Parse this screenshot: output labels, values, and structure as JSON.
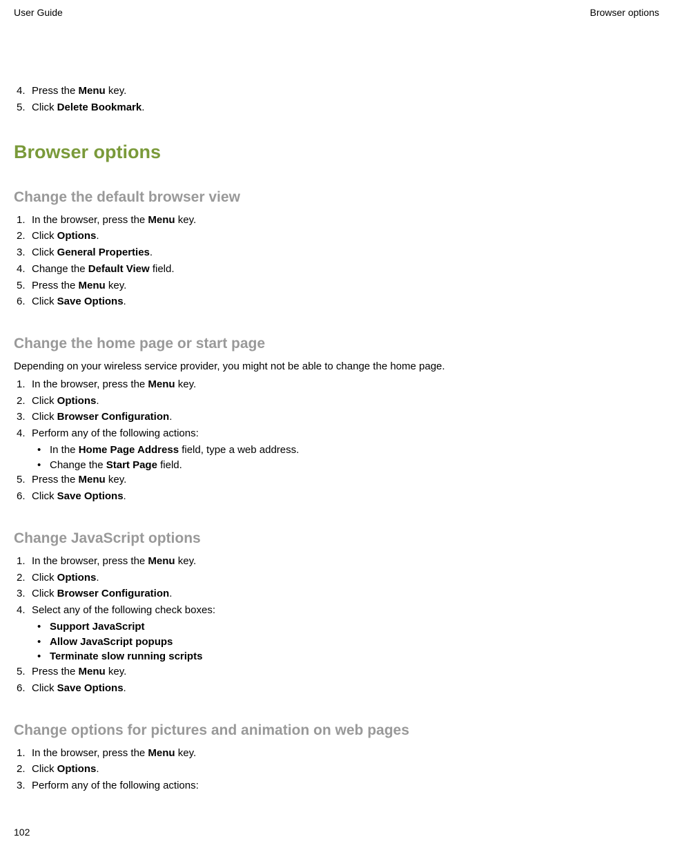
{
  "header": {
    "left": "User Guide",
    "right": "Browser options"
  },
  "intro_steps": [
    {
      "num": "4.",
      "parts": [
        "Press the ",
        "Menu",
        " key."
      ]
    },
    {
      "num": "5.",
      "parts": [
        "Click ",
        "Delete Bookmark",
        "."
      ]
    }
  ],
  "h1": "Browser options",
  "sections": [
    {
      "title": "Change the default browser view",
      "intro": null,
      "items": [
        {
          "type": "step",
          "num": "1.",
          "parts": [
            "In the browser, press the ",
            "Menu",
            " key."
          ]
        },
        {
          "type": "step",
          "num": "2.",
          "parts": [
            "Click ",
            "Options",
            "."
          ]
        },
        {
          "type": "step",
          "num": "3.",
          "parts": [
            "Click ",
            "General Properties",
            "."
          ]
        },
        {
          "type": "step",
          "num": "4.",
          "parts": [
            "Change the ",
            "Default View",
            " field."
          ]
        },
        {
          "type": "step",
          "num": "5.",
          "parts": [
            "Press the ",
            "Menu",
            " key."
          ]
        },
        {
          "type": "step",
          "num": "6.",
          "parts": [
            "Click ",
            "Save Options",
            "."
          ]
        }
      ]
    },
    {
      "title": "Change the home page or start page",
      "intro": "Depending on your wireless service provider, you might not be able to change the home page.",
      "items": [
        {
          "type": "step",
          "num": "1.",
          "parts": [
            "In the browser, press the ",
            "Menu",
            " key."
          ]
        },
        {
          "type": "step",
          "num": "2.",
          "parts": [
            "Click ",
            "Options",
            "."
          ]
        },
        {
          "type": "step",
          "num": "3.",
          "parts": [
            "Click ",
            "Browser Configuration",
            "."
          ]
        },
        {
          "type": "step",
          "num": "4.",
          "parts": [
            "Perform any of the following actions:"
          ]
        },
        {
          "type": "bullet",
          "parts": [
            "In the ",
            "Home Page Address",
            " field, type a web address."
          ]
        },
        {
          "type": "bullet",
          "parts": [
            "Change the ",
            "Start Page",
            " field."
          ]
        },
        {
          "type": "step",
          "num": "5.",
          "parts": [
            "Press the ",
            "Menu",
            " key."
          ]
        },
        {
          "type": "step",
          "num": "6.",
          "parts": [
            "Click ",
            "Save Options",
            "."
          ]
        }
      ]
    },
    {
      "title": "Change JavaScript options",
      "intro": null,
      "items": [
        {
          "type": "step",
          "num": "1.",
          "parts": [
            "In the browser, press the ",
            "Menu",
            " key."
          ]
        },
        {
          "type": "step",
          "num": "2.",
          "parts": [
            "Click ",
            "Options",
            "."
          ]
        },
        {
          "type": "step",
          "num": "3.",
          "parts": [
            "Click ",
            "Browser Configuration",
            "."
          ]
        },
        {
          "type": "step",
          "num": "4.",
          "parts": [
            "Select any of the following check boxes:"
          ]
        },
        {
          "type": "bullet",
          "parts": [
            "",
            "Support JavaScript",
            ""
          ]
        },
        {
          "type": "bullet",
          "parts": [
            "",
            "Allow JavaScript popups",
            ""
          ]
        },
        {
          "type": "bullet",
          "parts": [
            "",
            "Terminate slow running scripts",
            ""
          ]
        },
        {
          "type": "step",
          "num": "5.",
          "parts": [
            "Press the ",
            "Menu",
            " key."
          ]
        },
        {
          "type": "step",
          "num": "6.",
          "parts": [
            "Click ",
            "Save Options",
            "."
          ]
        }
      ]
    },
    {
      "title": "Change options for pictures and animation on web pages",
      "intro": null,
      "items": [
        {
          "type": "step",
          "num": "1.",
          "parts": [
            "In the browser, press the ",
            "Menu",
            " key."
          ]
        },
        {
          "type": "step",
          "num": "2.",
          "parts": [
            "Click ",
            "Options",
            "."
          ]
        },
        {
          "type": "step",
          "num": "3.",
          "parts": [
            "Perform any of the following actions:"
          ]
        }
      ]
    }
  ],
  "page_number": "102"
}
